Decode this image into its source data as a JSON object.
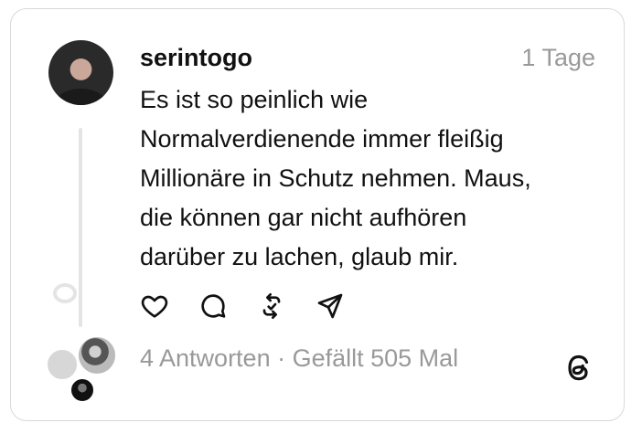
{
  "post": {
    "username": "serintogo",
    "time": "1 Tage",
    "lines": [
      "Es ist so peinlich wie",
      "Normalverdienende immer fleißig",
      "Millionäre in Schutz nehmen. Maus,",
      "die können gar nicht aufhören",
      "darüber zu lachen, glaub mir."
    ],
    "stats": "4 Antworten · Gefällt 505 Mal"
  },
  "icons": {
    "like": "heart-icon",
    "comment": "comment-icon",
    "repost": "repost-icon",
    "share": "send-icon",
    "logo": "threads-logo-icon"
  }
}
